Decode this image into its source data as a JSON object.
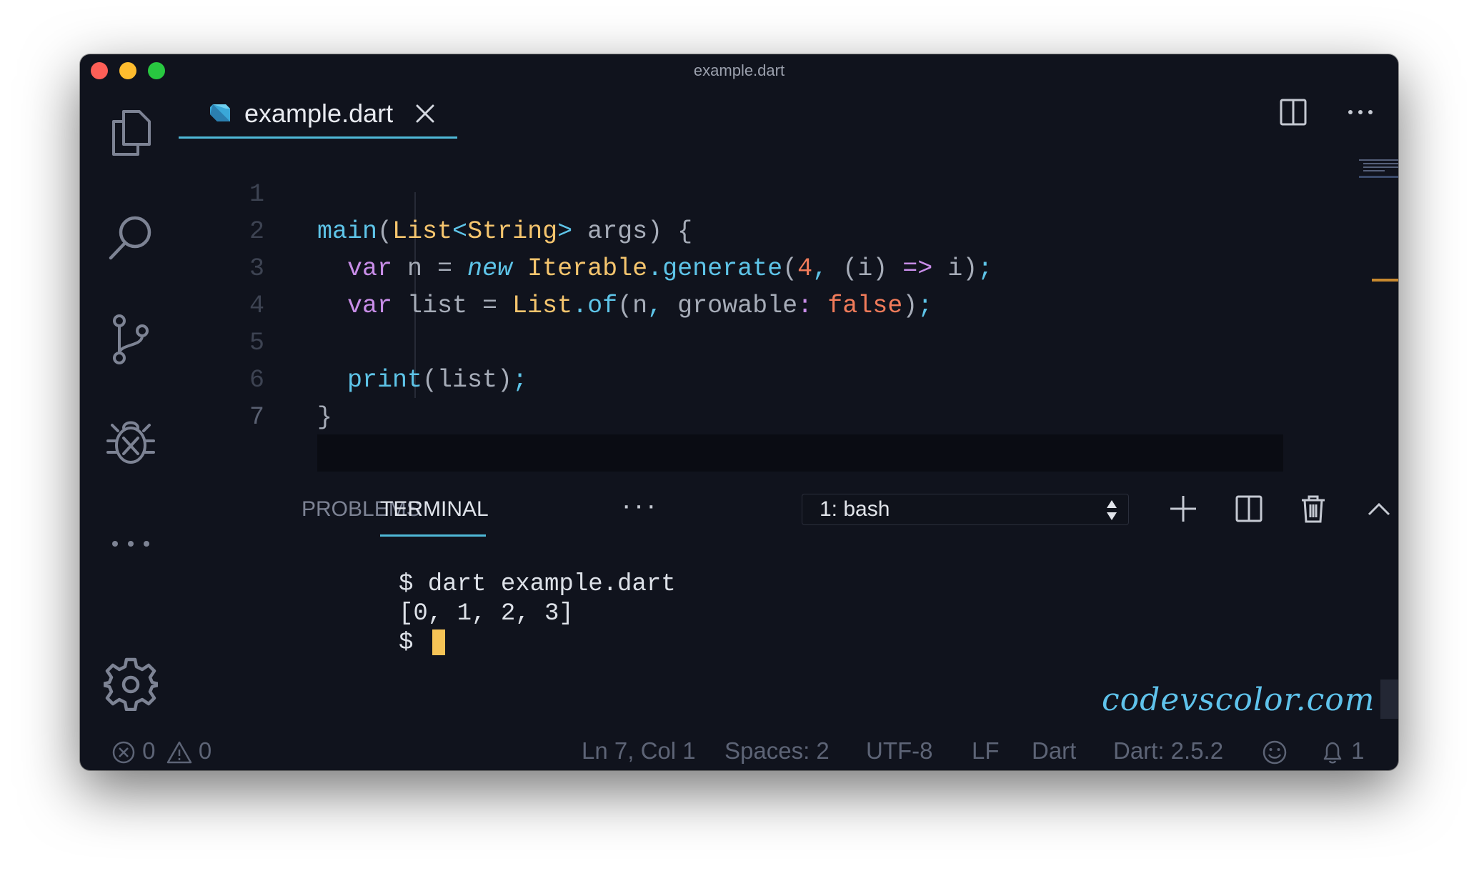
{
  "window": {
    "title": "example.dart"
  },
  "activity_bar": {
    "items": [
      "explorer-icon",
      "search-icon",
      "source-control-icon",
      "debug-icon",
      "more-icon",
      "settings-icon"
    ]
  },
  "editor": {
    "tab": {
      "label": "example.dart",
      "icon": "dart-icon"
    },
    "line_numbers": [
      "1",
      "2",
      "3",
      "4",
      "5",
      "6",
      "7"
    ],
    "code": {
      "l1": [
        "main",
        "(",
        "List",
        "<",
        "String",
        ">",
        " args) {"
      ],
      "l2": [
        "var",
        " n = ",
        "new",
        " ",
        "Iterable",
        ".",
        "generate",
        "(",
        "4",
        ",",
        " (i) ",
        "=>",
        " i)",
        ";"
      ],
      "l3": [
        "var",
        " list = ",
        "List",
        ".",
        "of",
        "(n",
        ",",
        " growable",
        ":",
        " ",
        "false",
        ")",
        ";"
      ],
      "l4": [],
      "l5": [
        "print",
        "(list)",
        ";"
      ],
      "l6": [
        "}"
      ],
      "l7": []
    }
  },
  "panel": {
    "tabs": {
      "problems": "PROBLEMS",
      "terminal": "TERMINAL",
      "more": "···"
    },
    "terminal_select": "1: bash",
    "terminal_lines": [
      "$ dart example.dart",
      "[0, 1, 2, 3]",
      "$ "
    ]
  },
  "watermark": "codevscolor.com",
  "status_bar": {
    "errors": "0",
    "warnings": "0",
    "position": "Ln 7, Col 1",
    "spaces": "Spaces: 2",
    "encoding": "UTF-8",
    "eol": "LF",
    "language": "Dart",
    "sdk": "Dart: 2.5.2",
    "notifications": "1"
  },
  "colors": {
    "background": "#10131d",
    "accent": "#4fb9d8",
    "function": "#5ec4e8",
    "type": "#f5c56e",
    "keyword": "#c88de8",
    "literal": "#f07b5a",
    "cursor": "#f5c356"
  }
}
